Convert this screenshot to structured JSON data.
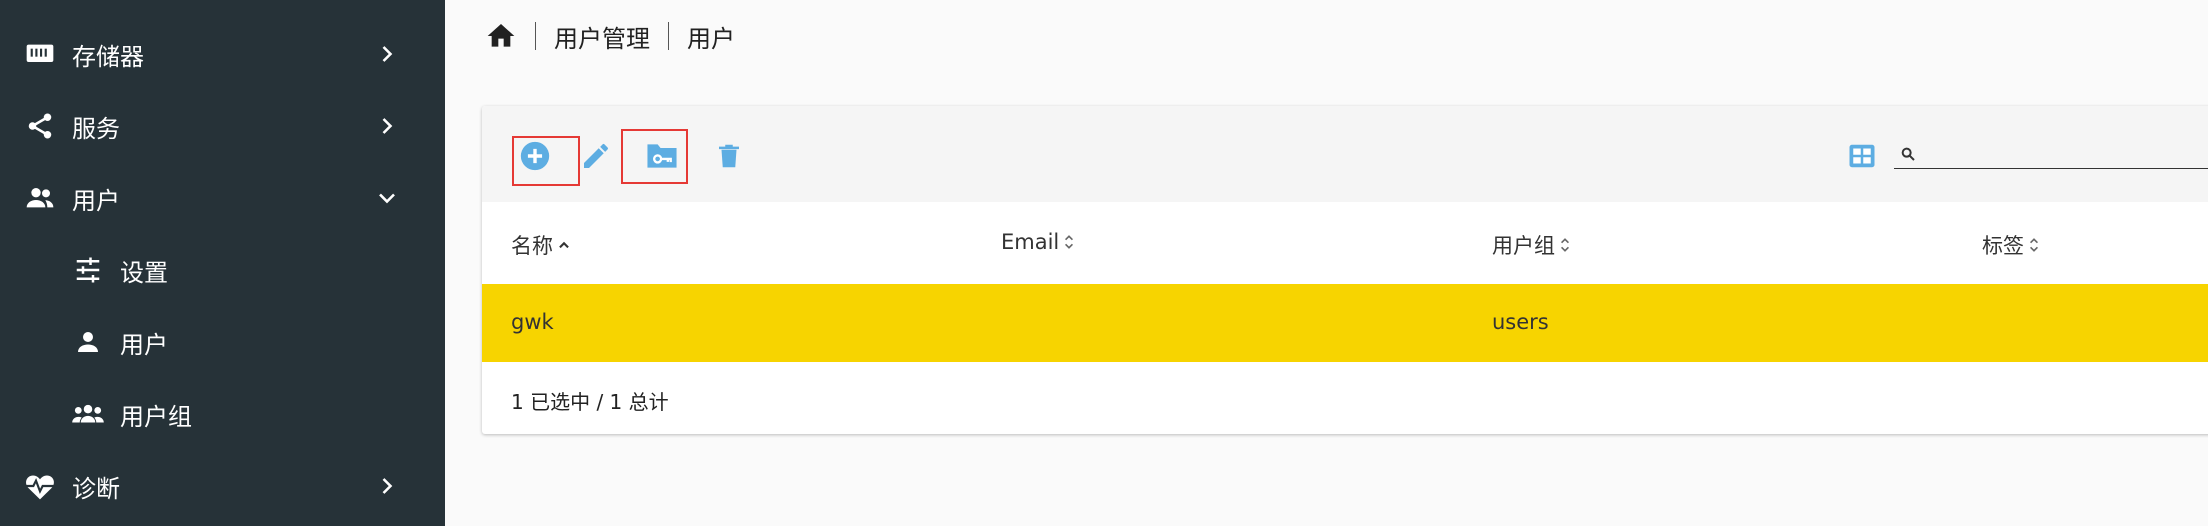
{
  "sidebar": {
    "items": [
      {
        "label": "存储器",
        "icon": "storage-icon"
      },
      {
        "label": "服务",
        "icon": "share-icon"
      },
      {
        "label": "用户",
        "icon": "people-icon"
      },
      {
        "label": "设置",
        "icon": "tune-icon"
      },
      {
        "label": "用户",
        "icon": "person-icon"
      },
      {
        "label": "用户组",
        "icon": "group-icon"
      },
      {
        "label": "诊断",
        "icon": "heart-pulse-icon"
      }
    ]
  },
  "breadcrumb": {
    "items": [
      "用户管理",
      "用户"
    ]
  },
  "toolbar": {
    "buttons": [
      "add-icon",
      "edit-icon",
      "folder-key-icon",
      "delete-icon"
    ],
    "accent": "#5dade2"
  },
  "table": {
    "columns": [
      "名称",
      "Email",
      "用户组",
      "标签"
    ],
    "rows": [
      {
        "name": "gwk",
        "email": "",
        "groups": "users",
        "tags": ""
      }
    ],
    "selected_color": "#f7d400",
    "footer": "1 已选中 / 1 总计"
  }
}
